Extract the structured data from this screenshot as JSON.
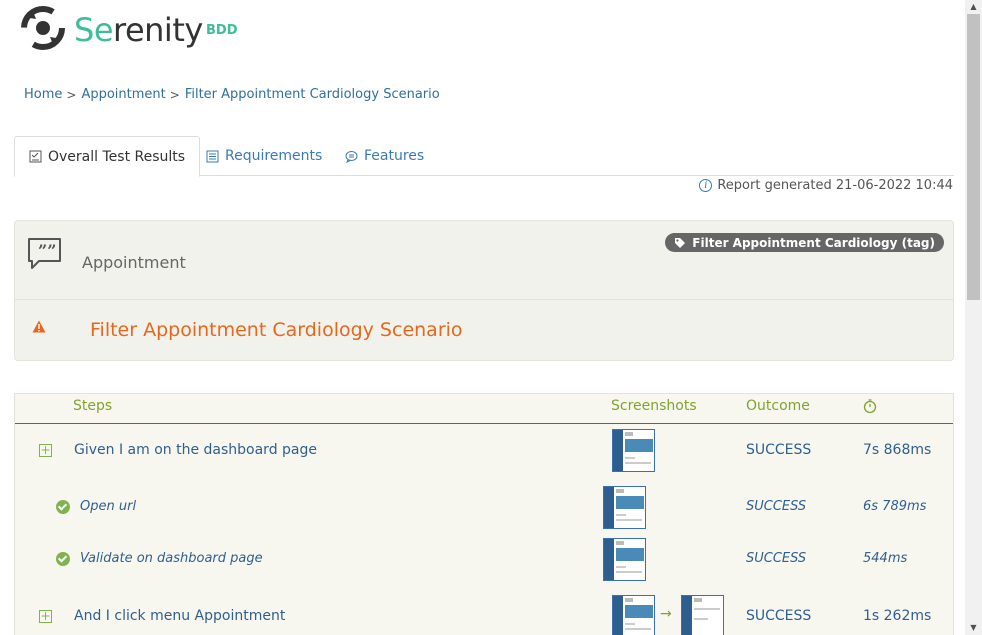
{
  "logo": {
    "prefix": "Se",
    "rest": "renity",
    "suffix": "BDD"
  },
  "breadcrumb": [
    {
      "label": "Home"
    },
    {
      "label": "Appointment"
    },
    {
      "label": "Filter Appointment Cardiology Scenario"
    }
  ],
  "tabs": [
    {
      "label": "Overall Test Results",
      "icon": "checklist-icon",
      "active": true
    },
    {
      "label": "Requirements",
      "icon": "list-icon",
      "active": false
    },
    {
      "label": "Features",
      "icon": "comment-icon",
      "active": false
    }
  ],
  "report": {
    "text": "Report generated 21-06-2022 10:44",
    "icon": "info-icon"
  },
  "feature": {
    "title": "Appointment",
    "tag": "Filter Appointment Cardiology (tag)"
  },
  "scenario": {
    "title": "Filter Appointment Cardiology Scenario",
    "icon": "warning-icon"
  },
  "table": {
    "headers": {
      "steps": "Steps",
      "screenshots": "Screenshots",
      "outcome": "Outcome",
      "duration_icon": "stopwatch-icon"
    },
    "rows": [
      {
        "step": "Given I am on the dashboard page",
        "outcome": "SUCCESS",
        "duration": "7s 868ms",
        "level": 0
      },
      {
        "step": "Open url",
        "outcome": "SUCCESS",
        "duration": "6s 789ms",
        "level": 1
      },
      {
        "step": "Validate on dashboard page",
        "outcome": "SUCCESS",
        "duration": "544ms",
        "level": 1
      },
      {
        "step": "And I click menu Appointment",
        "outcome": "SUCCESS",
        "duration": "1s 262ms",
        "level": 0
      }
    ]
  },
  "colors": {
    "brand": "#3dbd9a",
    "link": "#2f6f9f",
    "warning": "#e8671c",
    "success": "#7fb34f",
    "header": "#7fa32f"
  }
}
